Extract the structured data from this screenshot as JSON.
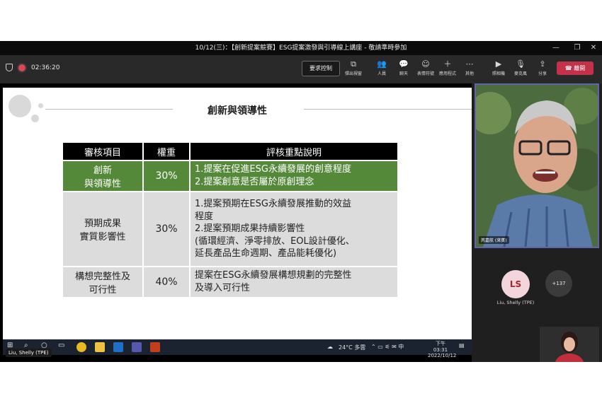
{
  "window": {
    "title": "10/12(三)：【創新提案競賽】ESG提案激發與引導線上講座 - 敬請準時參加"
  },
  "toolbar": {
    "timer": "02:36:20",
    "request_control": "要求控制",
    "tools": [
      {
        "label": "彈出視窗",
        "icon": "popout-icon"
      },
      {
        "label": "人員",
        "icon": "people-icon"
      },
      {
        "label": "聊天",
        "icon": "chat-icon"
      },
      {
        "label": "表情符號",
        "icon": "reactions-icon"
      },
      {
        "label": "應用程式",
        "icon": "apps-icon"
      },
      {
        "label": "其他",
        "icon": "more-icon"
      },
      {
        "label": "照相機",
        "icon": "camera-off-icon"
      },
      {
        "label": "麥克風",
        "icon": "mic-off-icon"
      },
      {
        "label": "分享",
        "icon": "share-icon"
      }
    ],
    "leave": "離開"
  },
  "slide": {
    "title": "創新與領導性",
    "headers": [
      "審核項目",
      "權重",
      "評核重點說明"
    ],
    "rows": [
      {
        "item": "創新\n與領導性",
        "weight": "30%",
        "detail": "1.提案在促進ESG永續發展的創意程度\n2.提案創意是否屬於原創理念"
      },
      {
        "item": "預期成果\n實質影響性",
        "weight": "30%",
        "detail": "1.提案預期在ESG永續發展推動的效益\n程度\n2.提案預期成果持續影響性\n(循環經濟、淨零排放、EOL設計優化、\n延長產品生命週期、產品能耗優化)"
      },
      {
        "item": "構想完整性及\n可行性",
        "weight": "40%",
        "detail": "提案在ESG永續發展構想規劃的完整性\n及導入可行性"
      }
    ]
  },
  "taskbar": {
    "weather": "24°C 多雲",
    "time": "下午 03:31",
    "date": "2022/10/12"
  },
  "presenter_tag": "Liu, Shelly (TPE)",
  "video": {
    "speaker_label": "芮嘉航 (來賓)"
  },
  "participants": {
    "initials": "LS",
    "name": "Liu, Shelly (TPE)",
    "more_count": "+137"
  },
  "colors": {
    "leave": "#c4314b",
    "green_row": "#55893a",
    "accent": "#6264a7"
  }
}
